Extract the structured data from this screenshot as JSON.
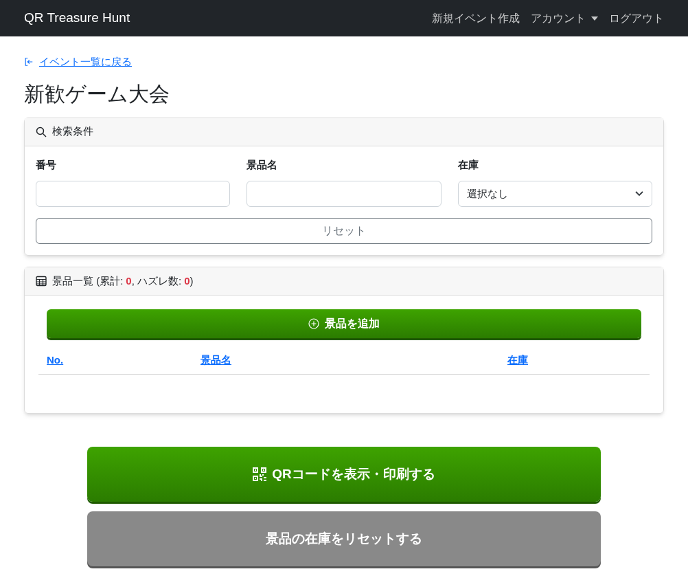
{
  "navbar": {
    "brand": "QR Treasure Hunt",
    "links": [
      {
        "label": "新規イベント作成",
        "dropdown": false
      },
      {
        "label": "アカウント",
        "dropdown": true
      },
      {
        "label": "ログアウト",
        "dropdown": false
      }
    ]
  },
  "back_link": "イベント一覧に戻る",
  "page_title": "新歓ゲーム大会",
  "search_card": {
    "title": "検索条件",
    "fields": [
      {
        "kind": "text",
        "label": "番号"
      },
      {
        "kind": "text",
        "label": "景品名"
      },
      {
        "kind": "select",
        "label": "在庫",
        "value": "選択なし"
      }
    ],
    "reset_button": "リセット"
  },
  "prize_card": {
    "title_parts": [
      {
        "kind": "text",
        "text": "景品一覧 (累計:"
      },
      {
        "kind": "count",
        "text": "0"
      },
      {
        "kind": "text",
        "text": ", ハズレ数:"
      },
      {
        "kind": "count",
        "text": "0"
      },
      {
        "kind": "text",
        "text": ")"
      }
    ],
    "add_button": "景品を追加",
    "columns": [
      "No.",
      "景品名",
      "在庫"
    ]
  },
  "buttons": [
    {
      "kind": "primary",
      "label": "QRコードを表示・印刷する"
    },
    {
      "kind": "secondary",
      "label": "景品の在庫をリセットする"
    }
  ]
}
